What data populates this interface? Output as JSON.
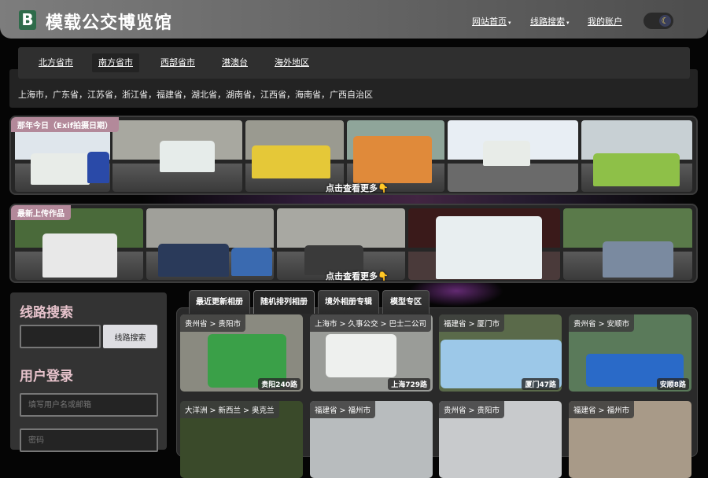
{
  "header": {
    "logo_letter": "B",
    "title": "模载公交博览馆",
    "nav": [
      {
        "label": "网站首页",
        "caret": "▾"
      },
      {
        "label": "线路搜索",
        "caret": "▾"
      },
      {
        "label": "我的账户"
      }
    ],
    "theme_toggle_icon": "moon-icon"
  },
  "regions": {
    "tabs": [
      "北方省市",
      "南方省市",
      "西部省市",
      "港澳台",
      "海外地区"
    ],
    "active": "南方省市",
    "provinces": "上海市，广东省，江苏省，浙江省，福建省，湖北省，湖南省，江西省，海南省，广西自治区"
  },
  "strips": [
    {
      "label": "那年今日（Exif拍摄日期）",
      "more": "点击查看更多👇"
    },
    {
      "label": "最新上传作品",
      "more": "点击查看更多👇"
    }
  ],
  "sidebar": {
    "search_title": "线路搜索",
    "search_button": "线路搜索",
    "login_title": "用户登录",
    "username_placeholder": "填写用户名或邮箱",
    "password_placeholder": "密码"
  },
  "gallery": {
    "tabs": [
      "最近更新相册",
      "随机排列相册",
      "境外相册专辑",
      "模型专区"
    ],
    "active_tab": "随机排列相册",
    "cards": [
      {
        "crumb": "贵州省 > 贵阳市",
        "caption": "贵阳240路"
      },
      {
        "crumb": "上海市 > 久事公交 > 巴士二公司",
        "caption": "上海729路"
      },
      {
        "crumb": "福建省 > 厦门市",
        "caption": "厦门47路"
      },
      {
        "crumb": "贵州省 > 安顺市",
        "caption": "安顺8路"
      },
      {
        "crumb": "大洋洲 > 新西兰 > 奥克兰"
      },
      {
        "crumb": "福建省 > 福州市"
      },
      {
        "crumb": "贵州省 > 贵阳市"
      },
      {
        "crumb": "福建省 > 福州市"
      }
    ]
  },
  "colors": {
    "accent_pink": "#e7c3cc",
    "badge": "#b3899a",
    "logo_green": "#2e6b4a"
  }
}
